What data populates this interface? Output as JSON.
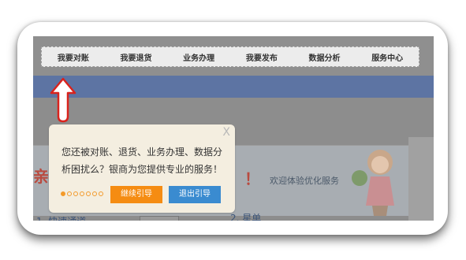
{
  "nav": {
    "items": [
      "我要对账",
      "我要退货",
      "业务办理",
      "我要发布",
      "数据分析",
      "服务中心"
    ]
  },
  "background": {
    "welcome": "欢迎体验优化服务",
    "step1": "1. 快速通道",
    "step2": "2. 星单",
    "banner_char": "亲",
    "banner_excl": "！"
  },
  "popup": {
    "close": "X",
    "line1": "您还被对账、退货、业务办理、数据分",
    "line2": "析困扰么？银商为您提供专业的服务！",
    "step_total": 7,
    "step_current": 1,
    "next_button": "继续引导",
    "exit_button": "退出引导"
  },
  "colors": {
    "accent_orange": "#f58c12",
    "accent_blue": "#3a8bd0",
    "arrow_red": "#d9231d",
    "popup_bg": "#f4eee0"
  }
}
